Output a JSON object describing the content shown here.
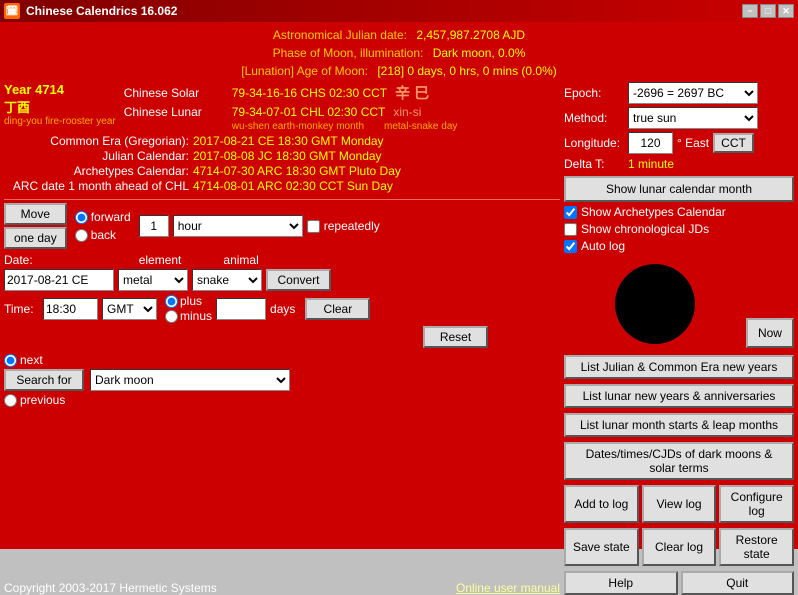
{
  "titleBar": {
    "icon": "🗓",
    "title": "Chinese Calendrics 16.062",
    "minimize": "−",
    "maximize": "□",
    "close": "✕"
  },
  "topInfo": {
    "julianLabel": "Astronomical Julian date:",
    "julianValue": "2,457,987.2708 AJD",
    "phaseLabel": "Phase of Moon, illumination:",
    "phaseValue": "Dark moon, 0.0%",
    "lunationLabel": "[Lunation] Age of Moon:",
    "lunationValue": "[218] 0 days, 0 hrs, 0 mins (0.0%)"
  },
  "calendarData": {
    "year": "Year 4714",
    "yearChinese": "丁酉",
    "yearSub": "ding-you fire-rooster year",
    "solarLabel": "Chinese Solar",
    "solarValue": "79-34-16-16 CHS 02:30 CCT",
    "solarExtra": "辛 巳",
    "lunarLabel": "Chinese Lunar",
    "lunarValue": "79-34-07-01 CHL 02:30 CCT",
    "lunarExtra": "xin-si",
    "lunarSub": "wu-shen earth-monkey month",
    "lunarSub2": "metal-snake day",
    "commonLabel": "Common Era (Gregorian):",
    "commonValue": "2017-08-21 CE 18:30 GMT Monday",
    "julianCalLabel": "Julian Calendar:",
    "julianCalValue": "2017-08-08 JC 18:30 GMT Monday",
    "archetypesLabel": "Archetypes Calendar:",
    "archetypesValue": "4714-07-30 ARC 18:30 GMT Pluto Day",
    "arcLabel": "ARC date 1 month ahead of CHL",
    "arcValue": "4714-08-01 ARC 02:30 CCT Sun Day"
  },
  "controls": {
    "moveBtn": "Move",
    "oneDayBtn": "one day",
    "forwardLabel": "forward",
    "backLabel": "back",
    "amountValue": "1",
    "hourOption": "hour",
    "repeatedlyLabel": "repeatedly"
  },
  "dateForm": {
    "dateLabel": "Date:",
    "dateValue": "2017-08-21 CE",
    "elementLabel": "element",
    "animalLabel": "animal",
    "elementValue": "metal",
    "animalValue": "snake",
    "convertBtn": "Convert",
    "clearBtn": "Clear",
    "resetBtn": "Reset",
    "timeLabel": "Time:",
    "timeValue": "18:30",
    "timezoneValue": "GMT",
    "plusLabel": "plus",
    "minusLabel": "minus",
    "daysLabel": "days"
  },
  "searchSection": {
    "searchForBtn": "Search for",
    "nextLabel": "next",
    "previousLabel": "previous",
    "darkMoonValue": "Dark moon"
  },
  "rightPanel": {
    "epochLabel": "Epoch:",
    "epochValue": "-2696 = 2697 BC",
    "methodLabel": "Method:",
    "methodValue": "true sun",
    "longitudeLabel": "Longitude:",
    "longitudeValue": "120",
    "eastLabel": "° East",
    "cctBtn": "CCT",
    "deltaTLabel": "Delta T:",
    "deltaTValue": "1 minute",
    "showLunarBtn": "Show lunar calendar month",
    "showArchetypesLabel": "Show Archetypes Calendar",
    "showChronologicalLabel": "Show chronological JDs",
    "autoLogLabel": "Auto log",
    "nowBtn": "Now"
  },
  "listButtons": {
    "listJulianBtn": "List Julian & Common Era new years",
    "listLunarBtn": "List lunar new years & anniversaries",
    "listLunarMonthBtn": "List lunar month starts & leap months",
    "datesDarkBtn": "Dates/times/CJDs of dark moons & solar terms",
    "addToLogBtn": "Add to log",
    "viewLogBtn": "View log",
    "configureLogBtn": "Configure log",
    "saveStateBtn": "Save state",
    "clearLogBtn": "Clear log",
    "restoreStateBtn": "Restore state",
    "helpBtn": "Help",
    "quitBtn": "Quit"
  },
  "footer": {
    "copyright": "Copyright 2003-2017 Hermetic Systems",
    "onlineManual": "Online user manual"
  }
}
